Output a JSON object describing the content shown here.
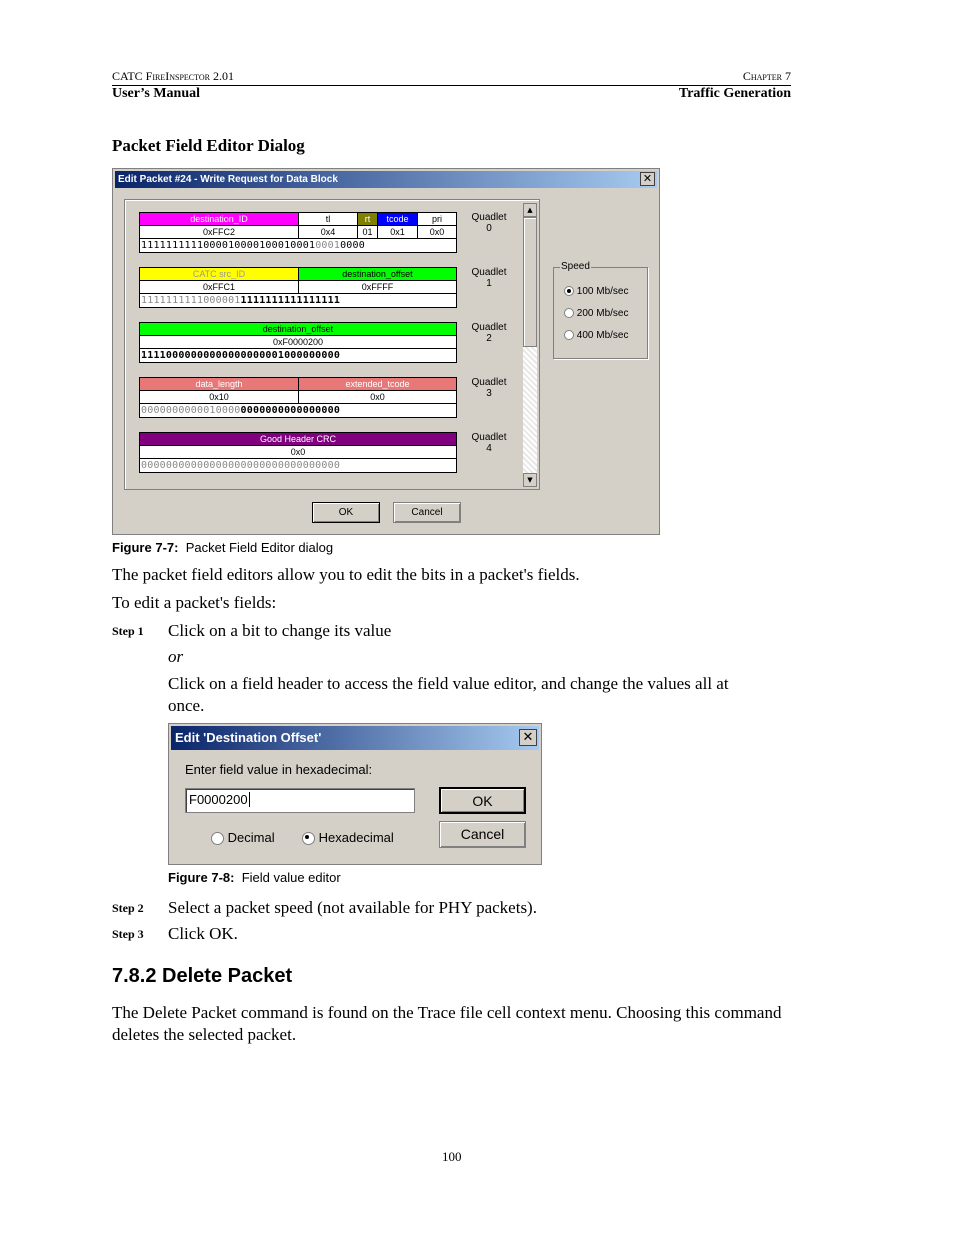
{
  "header": {
    "left_top": "CATC FireInspector 2.01",
    "right_top": "Chapter 7",
    "left_bottom": "User’s Manual",
    "right_bottom": "Traffic Generation"
  },
  "section_title": "Packet Field Editor Dialog",
  "fig1": {
    "title": "Edit Packet #24 - Write Request for Data Block",
    "quadlets": [
      {
        "label": "Quadlet\n0",
        "fields": [
          {
            "name": "destination_ID",
            "value": "0xFFC2",
            "color": "#ff00ff"
          },
          {
            "name": "tl",
            "value": "0x4",
            "color": "#ffffff"
          },
          {
            "name": "rt",
            "value": "01",
            "color": "#808000"
          },
          {
            "name": "tcode",
            "value": "0x1",
            "color": "#0000ff"
          },
          {
            "name": "pri",
            "value": "0x0",
            "color": "#ffffff"
          }
        ],
        "bits": "11111111111000010000100010001000010000",
        "bits_display_a": "1111111111000010000100010001",
        "bits_display_b": "0001",
        "bits_display_c": "0000"
      },
      {
        "label": "Quadlet\n1",
        "fields": [
          {
            "name": "CATC src_ID",
            "value": "0xFFC1",
            "color": "#ffff00"
          },
          {
            "name": "destination_offset",
            "value": "0xFFFF",
            "color": "#00ff00"
          }
        ],
        "bits_display_a": "1111111111000001",
        "bits_display_b": "1111111111111111"
      },
      {
        "label": "Quadlet\n2",
        "fields": [
          {
            "name": "destination_offset",
            "value": "0xF0000200",
            "color": "#00ff00"
          }
        ],
        "bits_display_a": "11110000000000000000001000000000"
      },
      {
        "label": "Quadlet\n3",
        "fields": [
          {
            "name": "data_length",
            "value": "0x10",
            "color": "#e87878"
          },
          {
            "name": "extended_tcode",
            "value": "0x0",
            "color": "#e87878"
          }
        ],
        "bits_display_a": "0000000000010000",
        "bits_display_b": "0000000000000000"
      },
      {
        "label": "Quadlet\n4",
        "fields": [
          {
            "name": "Good Header CRC",
            "value": "0x0",
            "color": "#800080"
          }
        ],
        "bits_display_a": "00000000000000000000000000000000"
      }
    ],
    "speed": {
      "label": "Speed",
      "options": [
        "100 Mb/sec",
        "200 Mb/sec",
        "400 Mb/sec"
      ],
      "selected": 0
    },
    "ok": "OK",
    "cancel": "Cancel",
    "caption_label": "Figure 7-7:",
    "caption_text": "Packet Field Editor dialog"
  },
  "para1": "The packet field editors allow you to edit the bits in a packet's fields.",
  "para2": "To edit a packet's fields:",
  "step1": {
    "label": "Step 1",
    "text": "Click on a bit to change its value",
    "or": "or",
    "text2": "Click on a field header to access the field value editor, and change the values all at once."
  },
  "fig2": {
    "title": "Edit 'Destination Offset'",
    "prompt": "Enter field value in hexadecimal:",
    "value": "F0000200",
    "ok": "OK",
    "cancel": "Cancel",
    "radio_decimal": "Decimal",
    "radio_hex": "Hexadecimal",
    "caption_label": "Figure 7-8:",
    "caption_text": "Field value editor"
  },
  "step2": {
    "label": "Step 2",
    "text": "Select a packet speed (not available for PHY packets)."
  },
  "step3": {
    "label": "Step 3",
    "text": "Click OK."
  },
  "h2": "7.8.2 Delete Packet",
  "para3": "The Delete Packet command is found on the Trace file cell context menu. Choosing this command deletes the selected packet.",
  "page_number": "100"
}
